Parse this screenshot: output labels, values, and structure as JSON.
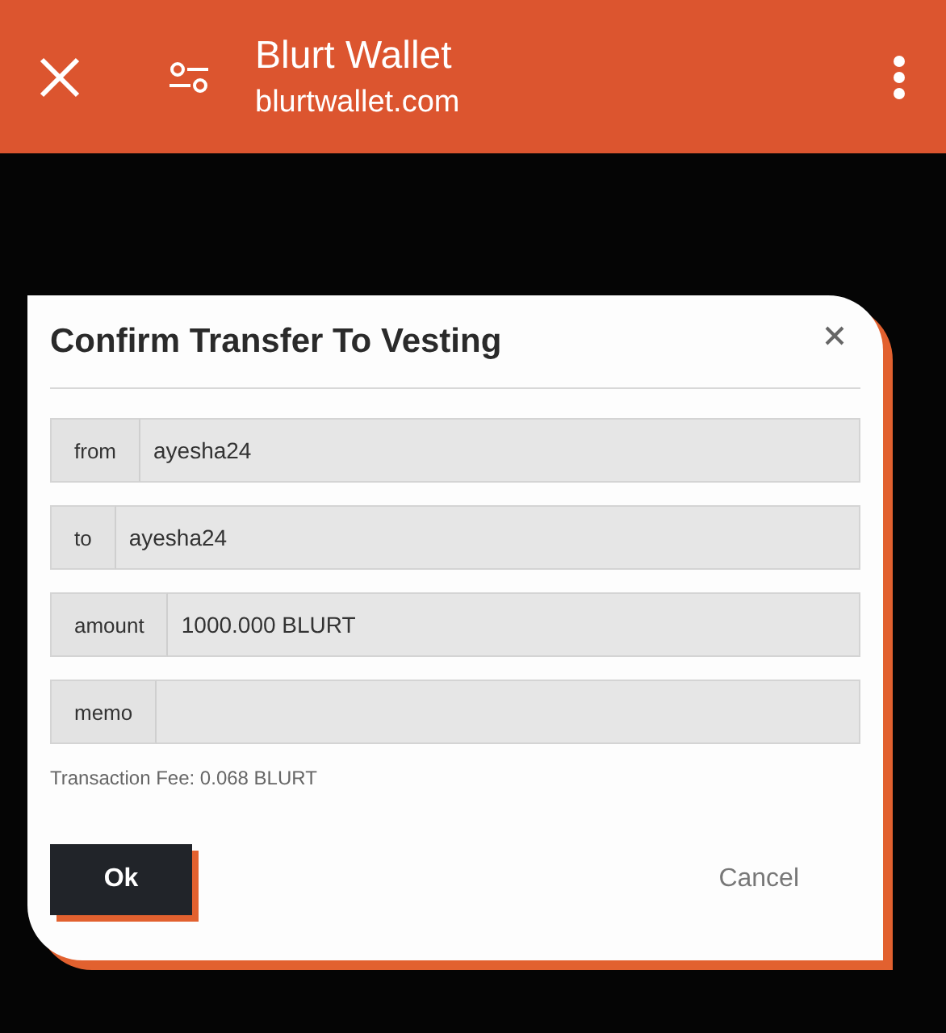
{
  "browser_bar": {
    "title": "Blurt Wallet",
    "url": "blurtwallet.com"
  },
  "dialog": {
    "title": "Confirm Transfer To Vesting",
    "fields": [
      {
        "label": "from",
        "value": "ayesha24"
      },
      {
        "label": "to",
        "value": "ayesha24"
      },
      {
        "label": "amount",
        "value": "1000.000 BLURT"
      },
      {
        "label": "memo"
      }
    ],
    "fee": "Transaction Fee: 0.068 BLURT",
    "buttons": [
      {
        "kind": "primary",
        "label": "Ok"
      },
      {
        "kind": "secondary",
        "label": "Cancel"
      }
    ]
  }
}
